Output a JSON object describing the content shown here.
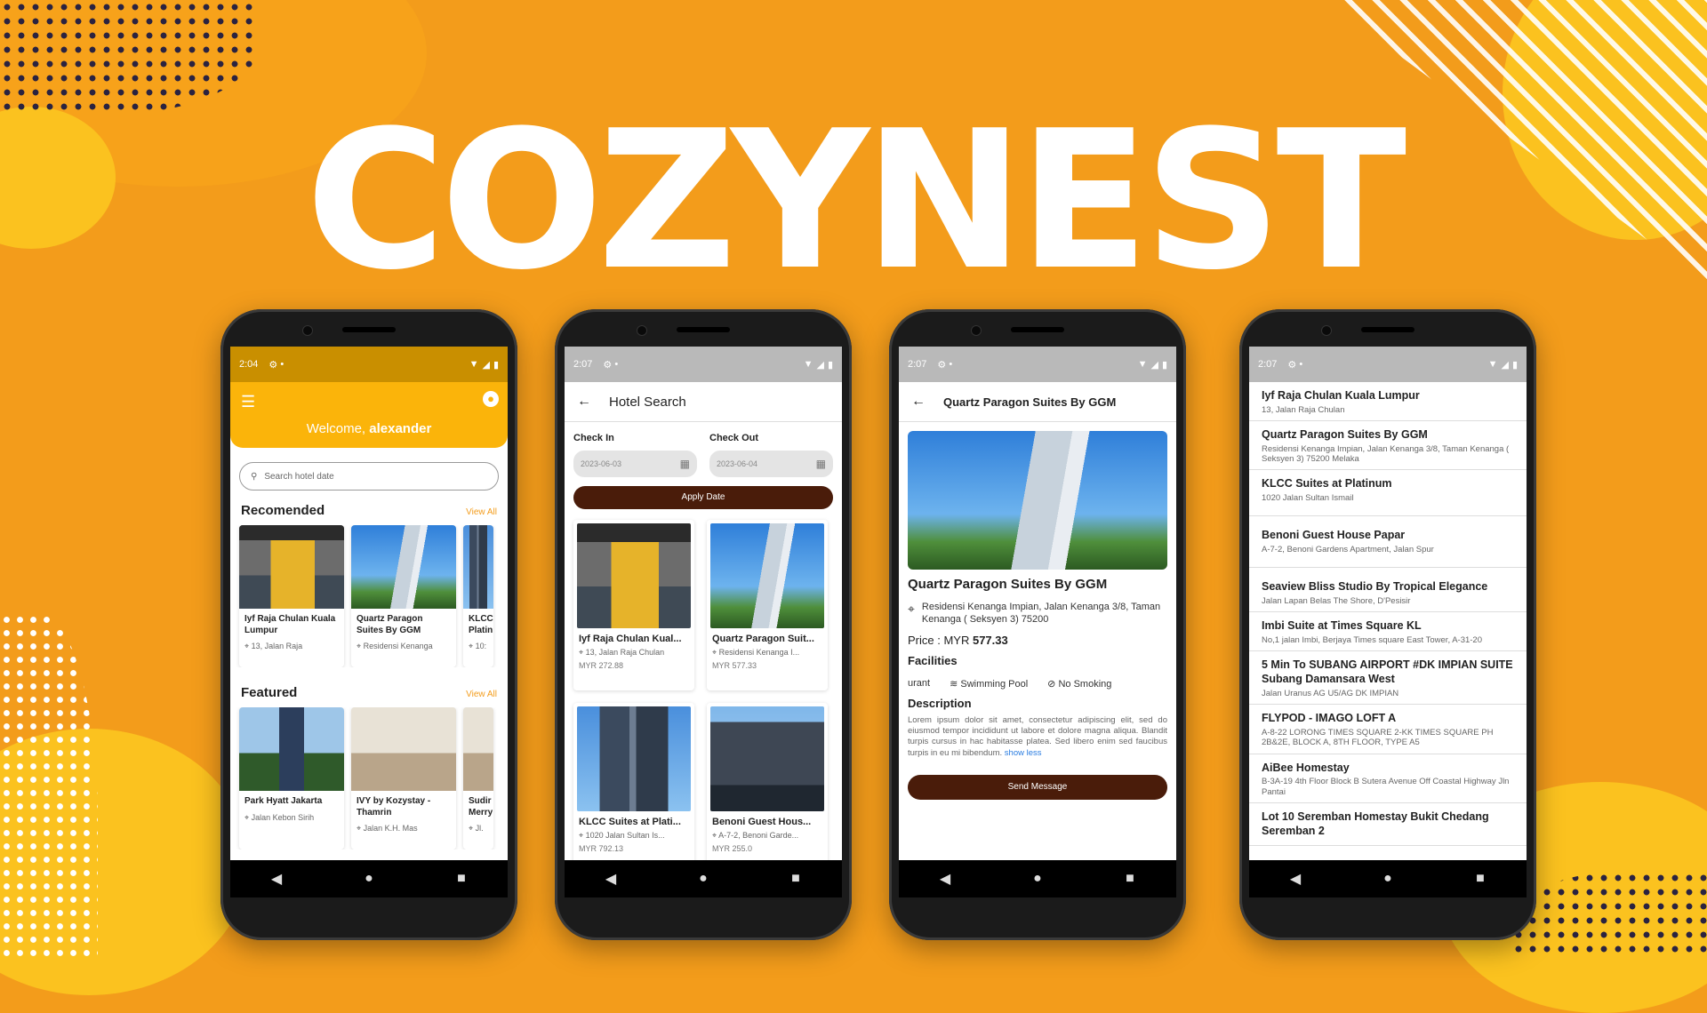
{
  "brand": "COZYNEST",
  "colors": {
    "background": "#F39C1B",
    "accent": "#FBB40A",
    "button": "#4A1C0A"
  },
  "phone1": {
    "status_time": "2:04",
    "welcome_prefix": "Welcome, ",
    "welcome_user": "alexander",
    "search_placeholder": "Search hotel date",
    "recommended": {
      "title": "Recomended",
      "view_all": "View All",
      "cards": [
        {
          "name": "Iyf Raja Chulan Kuala Lumpur",
          "address": "13, Jalan Raja"
        },
        {
          "name": "Quartz Paragon Suites By GGM",
          "address": "Residensi Kenanga"
        },
        {
          "name": "KLCC Platin",
          "address": "10:"
        }
      ]
    },
    "featured": {
      "title": "Featured",
      "view_all": "View All",
      "cards": [
        {
          "name": "Park Hyatt Jakarta",
          "address": "Jalan Kebon Sirih"
        },
        {
          "name": "IVY by Kozystay - Thamrin",
          "address": "Jalan K.H. Mas"
        },
        {
          "name": "Sudir Merry",
          "address": "Jl."
        }
      ]
    }
  },
  "phone2": {
    "status_time": "2:07",
    "title": "Hotel Search",
    "check_in_label": "Check In",
    "check_in_value": "2023-06-03",
    "check_out_label": "Check Out",
    "check_out_value": "2023-06-04",
    "apply_label": "Apply Date",
    "results": [
      {
        "name": "Iyf Raja Chulan Kual...",
        "address": "13, Jalan Raja Chulan",
        "price": "MYR 272.88"
      },
      {
        "name": "Quartz Paragon Suit...",
        "address": "Residensi Kenanga I...",
        "price": "MYR 577.33"
      },
      {
        "name": "KLCC Suites at Plati...",
        "address": "1020 Jalan Sultan Is...",
        "price": "MYR 792.13"
      },
      {
        "name": "Benoni Guest Hous...",
        "address": "A-7-2, Benoni Garde...",
        "price": "MYR 255.0"
      }
    ]
  },
  "phone3": {
    "status_time": "2:07",
    "title": "Quartz Paragon Suites By GGM",
    "hotel_name": "Quartz Paragon Suites By GGM",
    "address": "Residensi Kenanga Impian, Jalan Kenanga 3/8, Taman Kenanga ( Seksyen 3) 75200",
    "price_label": "Price : MYR ",
    "price_value": "577.33",
    "facilities_title": "Facilities",
    "facilities": [
      "urant",
      "Swimming Pool",
      "No Smoking"
    ],
    "description_title": "Description",
    "description": "Lorem ipsum dolor sit amet, consectetur adipiscing elit, sed do eiusmod tempor incididunt ut labore et dolore magna aliqua. Blandit turpis cursus in hac habitasse platea. Sed libero enim sed faucibus turpis in eu mi bibendum. ",
    "show_less": "show less",
    "send_label": "Send Message"
  },
  "phone4": {
    "status_time": "2:07",
    "items": [
      {
        "name": "Iyf Raja Chulan Kuala Lumpur",
        "address": "13, Jalan Raja Chulan"
      },
      {
        "name": "Quartz Paragon Suites By GGM",
        "address": "Residensi Kenanga Impian, Jalan Kenanga 3/8, Taman Kenanga ( Seksyen 3) 75200 Melaka"
      },
      {
        "name": "KLCC Suites at Platinum",
        "address": "1020 Jalan Sultan Ismail"
      },
      {
        "name": "Benoni Guest House Papar",
        "address": "A-7-2, Benoni Gardens Apartment, Jalan Spur"
      },
      {
        "name": "Seaview Bliss Studio By Tropical Elegance",
        "address": "Jalan Lapan Belas The Shore, D'Pesisir"
      },
      {
        "name": "Imbi Suite at Times Square KL",
        "address": "No,1 jalan Imbi, Berjaya Times square East Tower, A-31-20"
      },
      {
        "name": "5 Min To SUBANG AIRPORT #DK IMPIAN SUITE Subang Damansara West",
        "address": "Jalan Uranus AG U5/AG DK IMPIAN"
      },
      {
        "name": "FLYPOD - IMAGO LOFT A",
        "address": "A-8-22 LORONG TIMES SQUARE 2-KK TIMES SQUARE PH 2B&2E, BLOCK A, 8TH FLOOR, TYPE A5"
      },
      {
        "name": "AiBee Homestay",
        "address": "B-3A-19 4th Floor Block B Sutera Avenue Off Coastal Highway Jln Pantai"
      },
      {
        "name": "Lot 10 Seremban Homestay Bukit Chedang Seremban 2",
        "address": ""
      }
    ]
  }
}
